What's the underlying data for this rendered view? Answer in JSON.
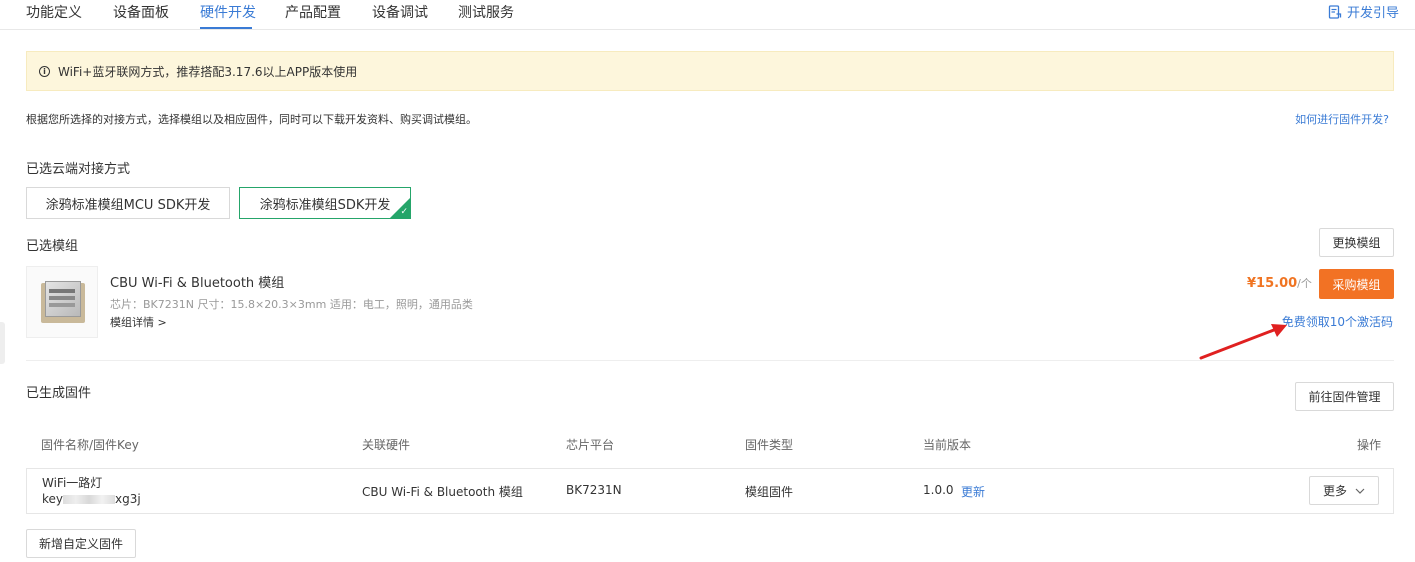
{
  "tabs": [
    {
      "label": "功能定义",
      "active": false
    },
    {
      "label": "设备面板",
      "active": false
    },
    {
      "label": "硬件开发",
      "active": true
    },
    {
      "label": "产品配置",
      "active": false
    },
    {
      "label": "设备调试",
      "active": false
    },
    {
      "label": "测试服务",
      "active": false
    }
  ],
  "guide_label": "开发引导",
  "notice": "WiFi+蓝牙联网方式，推荐搭配3.17.6以上APP版本使用",
  "description": "根据您所选择的对接方式，选择模组以及相应固件，同时可以下载开发资料、购买调试模组。",
  "howto_link": "如何进行固件开发?",
  "cloud_section": {
    "title": "已选云端对接方式",
    "options": [
      {
        "label": "涂鸦标准模组MCU SDK开发",
        "selected": false
      },
      {
        "label": "涂鸦标准模组SDK开发",
        "selected": true
      }
    ]
  },
  "module_section": {
    "title": "已选模组",
    "change_button": "更换模组",
    "name": "CBU Wi-Fi & Bluetooth 模组",
    "meta": "芯片：BK7231N   尺寸：15.8×20.3×3mm   适用：电工，照明，通用品类",
    "details_link": "模组详情 >",
    "price": "¥15.00",
    "price_unit": "/个",
    "buy_button": "采购模组",
    "free_link": "免费领取10个激活码"
  },
  "firmware_section": {
    "title": "已生成固件",
    "manage_button": "前往固件管理",
    "columns": [
      "固件名称/固件Key",
      "关联硬件",
      "芯片平台",
      "固件类型",
      "当前版本",
      "操作"
    ],
    "rows": [
      {
        "name": "WiFi一路灯",
        "key_prefix": "key",
        "key_suffix": "xg3j",
        "hardware": "CBU Wi-Fi & Bluetooth 模组",
        "chip": "BK7231N",
        "type": "模组固件",
        "version": "1.0.0",
        "update_label": "更新",
        "more_label": "更多"
      }
    ],
    "add_button": "新增自定义固件"
  },
  "colors": {
    "accent": "#3a7bd5",
    "selected_border": "#25a56a",
    "buy": "#f27224",
    "price": "#f07422",
    "notice_bg": "#fdf6dc",
    "arrow": "#e02020"
  },
  "icons": [
    "info-icon",
    "guide-icon",
    "check-icon",
    "chevron-down-icon"
  ]
}
